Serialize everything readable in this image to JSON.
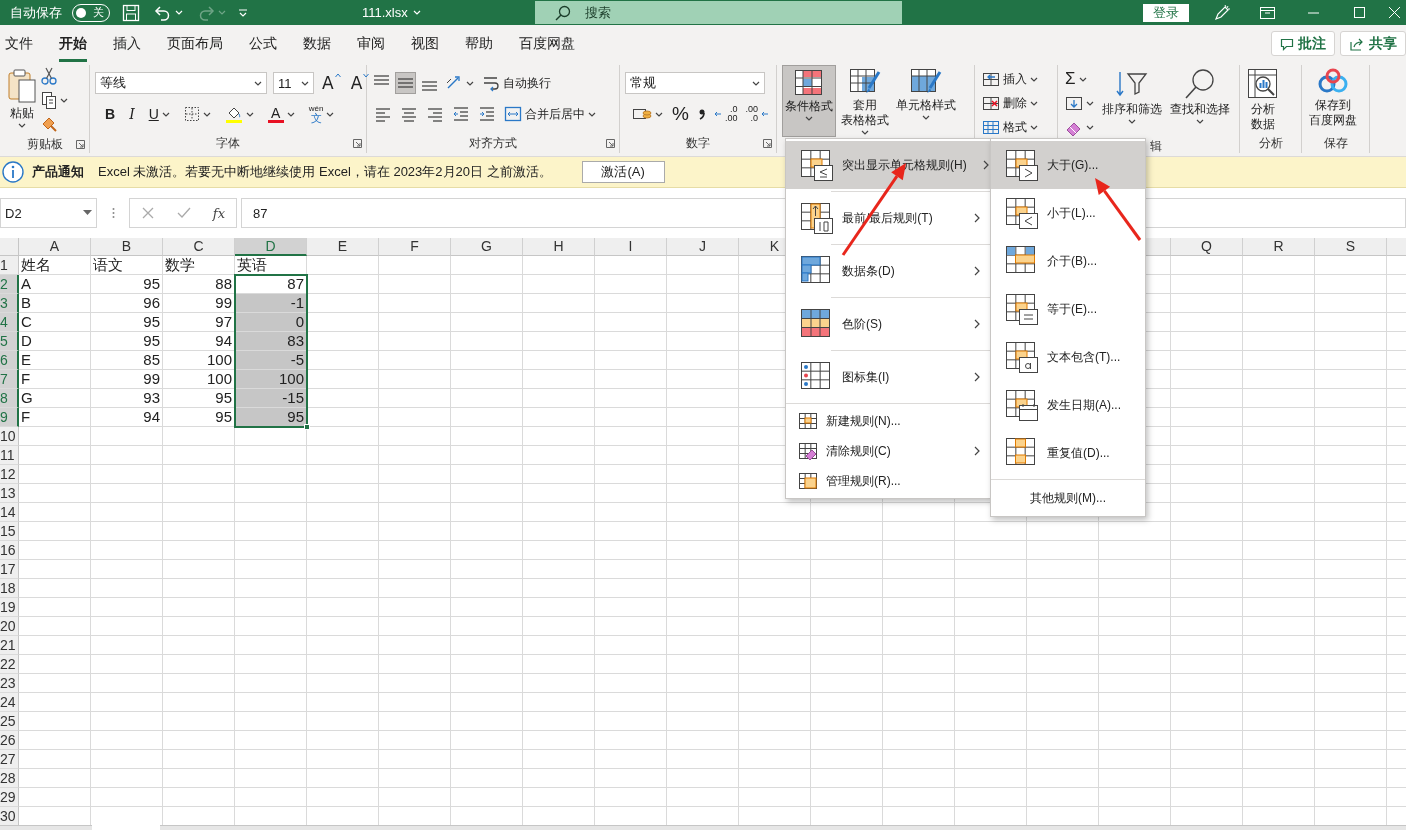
{
  "title_bar": {
    "autosave_label": "自动保存",
    "autosave_toggle": {
      "label": "关",
      "on": false
    },
    "quick_access": [
      {
        "kind": "save",
        "disabled": false
      },
      {
        "kind": "undo",
        "disabled": false
      },
      {
        "kind": "redo",
        "disabled": true
      }
    ],
    "file_name": "111.xlsx",
    "search_placeholder": "搜索",
    "sign_in": "登录"
  },
  "ribbon_tabs": [
    {
      "label": "文件",
      "selected": false
    },
    {
      "label": "开始",
      "selected": true
    },
    {
      "label": "插入",
      "selected": false
    },
    {
      "label": "页面布局",
      "selected": false
    },
    {
      "label": "公式",
      "selected": false
    },
    {
      "label": "数据",
      "selected": false
    },
    {
      "label": "审阅",
      "selected": false
    },
    {
      "label": "视图",
      "selected": false
    },
    {
      "label": "帮助",
      "selected": false
    },
    {
      "label": "百度网盘",
      "selected": false
    }
  ],
  "comments_button": "批注",
  "share_button": "共享",
  "ribbon": {
    "clipboard": {
      "label": "剪贴板",
      "paste": "粘贴"
    },
    "font": {
      "label": "字体",
      "font_name": "等线",
      "font_size": "11",
      "grow": "A",
      "shrink": "A",
      "bold": "B",
      "italic": "I",
      "underline": "U",
      "font_color": "A",
      "phonetic": "wén",
      "phonetic_char": "文"
    },
    "alignment": {
      "label": "对齐方式",
      "vertical_align": [
        {
          "selected": false
        },
        {
          "selected": true
        },
        {
          "selected": false
        }
      ],
      "wrap_text": "自动换行",
      "merge_center": "合并后居中"
    },
    "number": {
      "label": "数字",
      "format": "常规",
      "percent": "%",
      "increase_decimal": [
        ".0",
        ".00"
      ],
      "decrease_decimal": [
        ".00",
        ".0"
      ]
    },
    "styles": {
      "conditional_format": {
        "label": "条件格式",
        "pressed": true
      },
      "format_as_table": [
        "套用",
        "表格格式"
      ],
      "cell_styles": "单元格样式"
    },
    "cells": [
      "插入",
      "删除",
      "格式"
    ],
    "editing": {
      "label": "辑",
      "autosum": "Σ",
      "sort_filter": "排序和筛选",
      "find_select": "查找和选择"
    },
    "analysis": {
      "label": "分析",
      "button": [
        "分析",
        "数据"
      ]
    },
    "save": {
      "label": "保存",
      "button": [
        "保存到",
        "百度网盘"
      ]
    }
  },
  "notification": {
    "title": "产品通知",
    "message": "Excel 未激活。若要无中断地继续使用 Excel，请在 2023年2月20日 之前激活。",
    "button": "激活(A)"
  },
  "formula_bar": {
    "name_box": "D2",
    "function_label": "fx",
    "value": "87"
  },
  "sheet": {
    "columns_left": [
      {
        "label": "A",
        "selected": false,
        "kind": "text"
      },
      {
        "label": "B",
        "selected": false,
        "kind": "number"
      },
      {
        "label": "C",
        "selected": false,
        "kind": "number"
      },
      {
        "label": "D",
        "selected": true,
        "kind": "number"
      },
      {
        "label": "E",
        "selected": false
      },
      {
        "label": "F",
        "selected": false
      },
      {
        "label": "G",
        "selected": false
      },
      {
        "label": "H",
        "selected": false
      },
      {
        "label": "I",
        "selected": false
      },
      {
        "label": "J",
        "selected": false
      },
      {
        "label": "K",
        "selected": false
      }
    ],
    "columns_right": [
      {
        "label": "Q",
        "selected": false
      },
      {
        "label": "R",
        "selected": false
      },
      {
        "label": "S",
        "selected": false
      }
    ],
    "rows": [
      {
        "number": "1",
        "selected": false,
        "kind": "header",
        "cells": [
          "姓名",
          "语文",
          "数学",
          "英语"
        ]
      },
      {
        "number": "2",
        "selected": true,
        "kind": "data",
        "cells": [
          "A",
          "95",
          "88",
          "87"
        ]
      },
      {
        "number": "3",
        "selected": true,
        "kind": "data",
        "cells": [
          "B",
          "96",
          "99",
          "-1"
        ]
      },
      {
        "number": "4",
        "selected": true,
        "kind": "data",
        "cells": [
          "C",
          "95",
          "97",
          "0"
        ]
      },
      {
        "number": "5",
        "selected": true,
        "kind": "data",
        "cells": [
          "D",
          "95",
          "94",
          "83"
        ]
      },
      {
        "number": "6",
        "selected": true,
        "kind": "data",
        "cells": [
          "E",
          "85",
          "100",
          "-5"
        ]
      },
      {
        "number": "7",
        "selected": true,
        "kind": "data",
        "cells": [
          "F",
          "99",
          "100",
          "100"
        ]
      },
      {
        "number": "8",
        "selected": true,
        "kind": "data",
        "cells": [
          "G",
          "93",
          "95",
          "-15"
        ]
      },
      {
        "number": "9",
        "selected": true,
        "kind": "data",
        "cells": [
          "F",
          "94",
          "95",
          "95"
        ]
      },
      {
        "number": "10",
        "selected": false,
        "kind": "empty"
      },
      {
        "number": "11",
        "selected": false,
        "kind": "empty"
      },
      {
        "number": "12",
        "selected": false,
        "kind": "empty"
      },
      {
        "number": "13",
        "selected": false,
        "kind": "empty"
      },
      {
        "number": "14",
        "selected": false,
        "kind": "empty"
      },
      {
        "number": "15",
        "selected": false,
        "kind": "empty"
      },
      {
        "number": "16",
        "selected": false,
        "kind": "empty"
      },
      {
        "number": "17",
        "selected": false,
        "kind": "empty"
      },
      {
        "number": "18",
        "selected": false,
        "kind": "empty"
      },
      {
        "number": "19",
        "selected": false,
        "kind": "empty"
      },
      {
        "number": "20",
        "selected": false,
        "kind": "empty"
      },
      {
        "number": "21",
        "selected": false,
        "kind": "empty"
      },
      {
        "number": "22",
        "selected": false,
        "kind": "empty"
      },
      {
        "number": "23",
        "selected": false,
        "kind": "empty"
      },
      {
        "number": "24",
        "selected": false,
        "kind": "empty"
      },
      {
        "number": "25",
        "selected": false,
        "kind": "empty"
      },
      {
        "number": "26",
        "selected": false,
        "kind": "empty"
      },
      {
        "number": "27",
        "selected": false,
        "kind": "empty"
      },
      {
        "number": "28",
        "selected": false,
        "kind": "empty"
      },
      {
        "number": "29",
        "selected": false,
        "kind": "empty"
      },
      {
        "number": "30",
        "selected": false,
        "kind": "empty"
      }
    ]
  },
  "conditional_format_menu": [
    {
      "label": "突出显示单元格规则(H)",
      "kind": "large",
      "submenu": true,
      "selected": true
    },
    {
      "label": "最前/最后规则(T)",
      "kind": "large",
      "submenu": true,
      "selected": false
    },
    {
      "label": "数据条(D)",
      "kind": "large",
      "submenu": true,
      "selected": false
    },
    {
      "label": "色阶(S)",
      "kind": "large",
      "submenu": true,
      "selected": false
    },
    {
      "label": "图标集(I)",
      "kind": "large",
      "submenu": true,
      "selected": false
    },
    {
      "label": "新建规则(N)...",
      "kind": "small",
      "submenu": false,
      "selected": false
    },
    {
      "label": "清除规则(C)",
      "kind": "small",
      "submenu": true,
      "selected": false
    },
    {
      "label": "管理规则(R)...",
      "kind": "small",
      "submenu": false,
      "selected": false
    }
  ],
  "highlight_rules_submenu": {
    "items": [
      {
        "label": "大于(G)...",
        "selected": true
      },
      {
        "label": "小于(L)...",
        "selected": false
      },
      {
        "label": "介于(B)...",
        "selected": false
      },
      {
        "label": "等于(E)...",
        "selected": false
      },
      {
        "label": "文本包含(T)...",
        "selected": false
      },
      {
        "label": "发生日期(A)...",
        "selected": false
      },
      {
        "label": "重复值(D)...",
        "selected": false
      }
    ],
    "more_rules": "其他规则(M)..."
  },
  "annotations": [
    {
      "kind": "arrow"
    },
    {
      "kind": "arrow"
    }
  ]
}
